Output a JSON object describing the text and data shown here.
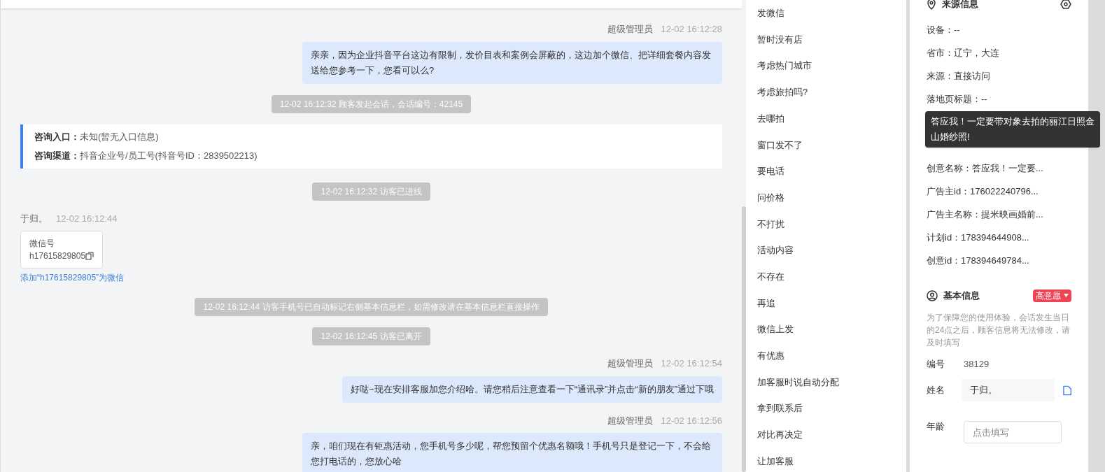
{
  "chat": {
    "messages": [
      {
        "kind": "agent",
        "sender": "超级管理员",
        "time": "12-02 16:12:28",
        "text": "亲亲，因为企业抖音平台这边有限制，发价目表和案例会屏蔽的，这边加个微信、把详细套餐内容发送给您参考一下，您看可以么?"
      },
      {
        "kind": "notice",
        "text": "12-02 16:12:32 顾客发起会话，会话编号：42145"
      },
      {
        "kind": "entry",
        "rows": [
          {
            "label": "咨询入口：",
            "value": "未知(暂无入口信息)"
          },
          {
            "label": "咨询渠道：",
            "value": "抖音企业号/员工号(抖音号ID：2839502213)"
          }
        ]
      },
      {
        "kind": "notice",
        "text": "12-02 16:12:32 访客已进线"
      },
      {
        "kind": "visitor",
        "sender": "于归。",
        "time": "12-02 16:12:44",
        "card_title": "微信号",
        "card_value": "h17615829805",
        "link": "添加“h17615829805”为微信"
      },
      {
        "kind": "notice",
        "text": "12-02 16:12:44 访客手机号已自动标记右侧基本信息栏，如需修改请在基本信息栏直接操作"
      },
      {
        "kind": "notice",
        "text": "12-02 16:12:45 访客已离开"
      },
      {
        "kind": "agent",
        "sender": "超级管理员",
        "time": "12-02 16:12:54",
        "text": "好哒~现在安排客服加您介绍哈。请您稍后注意查看一下“通讯录”并点击“新的朋友”通过下哦"
      },
      {
        "kind": "agent",
        "sender": "超级管理员",
        "time": "12-02 16:12:56",
        "text": "亲，咱们现在有钜惠活动，您手机号多少呢，帮您预留个优惠名额哦！手机号只是登记一下，不会给您打电话的，您放心哈"
      }
    ]
  },
  "quick_replies": [
    "发微信",
    "暂时没有店",
    "考虑热门城市",
    "考虑旅拍吗?",
    "去哪拍",
    "窗口发不了",
    "要电话",
    "问价格",
    "不打扰",
    "活动内容",
    "不存在",
    "再追",
    "微信上发",
    "有优惠",
    "加客服时说自动分配",
    "拿到联系后",
    "对比再决定",
    "让加客服"
  ],
  "source_info": {
    "title": "来源信息",
    "rows_top": [
      "设备：--",
      "省市：辽宁，大连",
      "来源：直接访问",
      "落地页标题：--"
    ],
    "tooltip": "答应我！一定要带对象去拍的丽江日照金山婚纱照!",
    "rows_bottom": [
      "创意名称：答应我！一定要...",
      "广告主id：176022240796...",
      "广告主名称：提米映画婚前...",
      "计划id：178394644908...",
      "创意id：178394649784..."
    ]
  },
  "basic_info": {
    "title": "基本信息",
    "tag": "高意愿",
    "note": "为了保障您的使用体验，会话发生当日的24点之后，顾客信息将无法修改，请及时填写",
    "fields": [
      {
        "kind": "text",
        "label": "编号",
        "value": "38129"
      },
      {
        "kind": "filled",
        "label": "姓名",
        "value": "于归。"
      },
      {
        "kind": "input",
        "label": "年龄",
        "placeholder": "点击填写"
      }
    ]
  }
}
